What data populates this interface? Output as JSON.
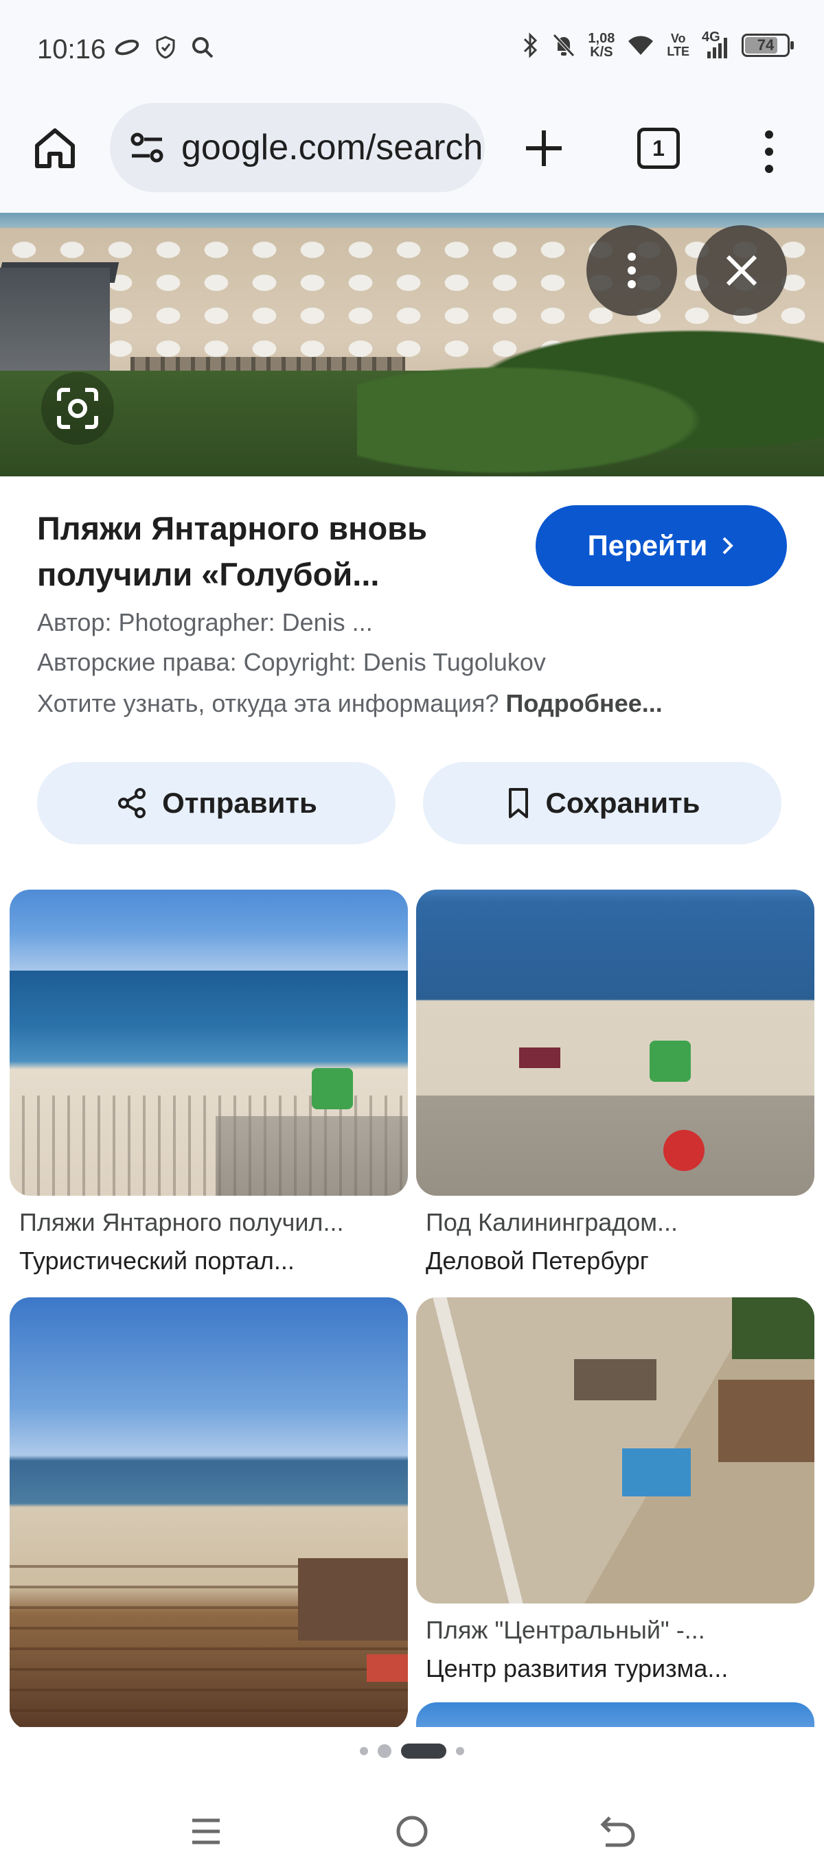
{
  "status_bar": {
    "time": "10:16",
    "net_speed_value": "1,08",
    "net_speed_unit": "K/S",
    "volte_top": "Vo",
    "volte_bottom": "LTE",
    "network": "4G",
    "battery": "74",
    "battery_level": 0.74
  },
  "toolbar": {
    "url": "google.com/search",
    "tab_count": "1"
  },
  "detail": {
    "title": "Пляжи Янтарного вновь получили «Голубой...",
    "go_label": "Перейти",
    "author": "Автор: Photographer: Denis ...",
    "copyright": "Авторские права: Copyright: Denis Tugolukov",
    "info_question": "Хотите узнать, откуда эта информация?",
    "info_link": "Подробнее...",
    "share_label": "Отправить",
    "save_label": "Сохранить"
  },
  "results": [
    {
      "title": "Пляжи Янтарного получил...",
      "source": "Туристический портал..."
    },
    {
      "title": "Под Калининградом...",
      "source": "Деловой Петербург"
    },
    {
      "title": "",
      "source": ""
    },
    {
      "title": "Пляж \"Центральный\" -...",
      "source": "Центр развития туризма..."
    }
  ],
  "colors": {
    "accent": "#0b57d0",
    "chip_bg": "#e8f0fb",
    "toolbar_bg": "#f8f9fc"
  },
  "icons": {
    "home": "home-icon",
    "site_settings": "tune-icon",
    "new_tab": "plus-icon",
    "menu": "more-vert-icon",
    "lens": "lens-icon",
    "close": "close-icon",
    "share": "share-icon",
    "save": "bookmark-icon"
  },
  "pager": {
    "pages": 4,
    "active": 3
  }
}
